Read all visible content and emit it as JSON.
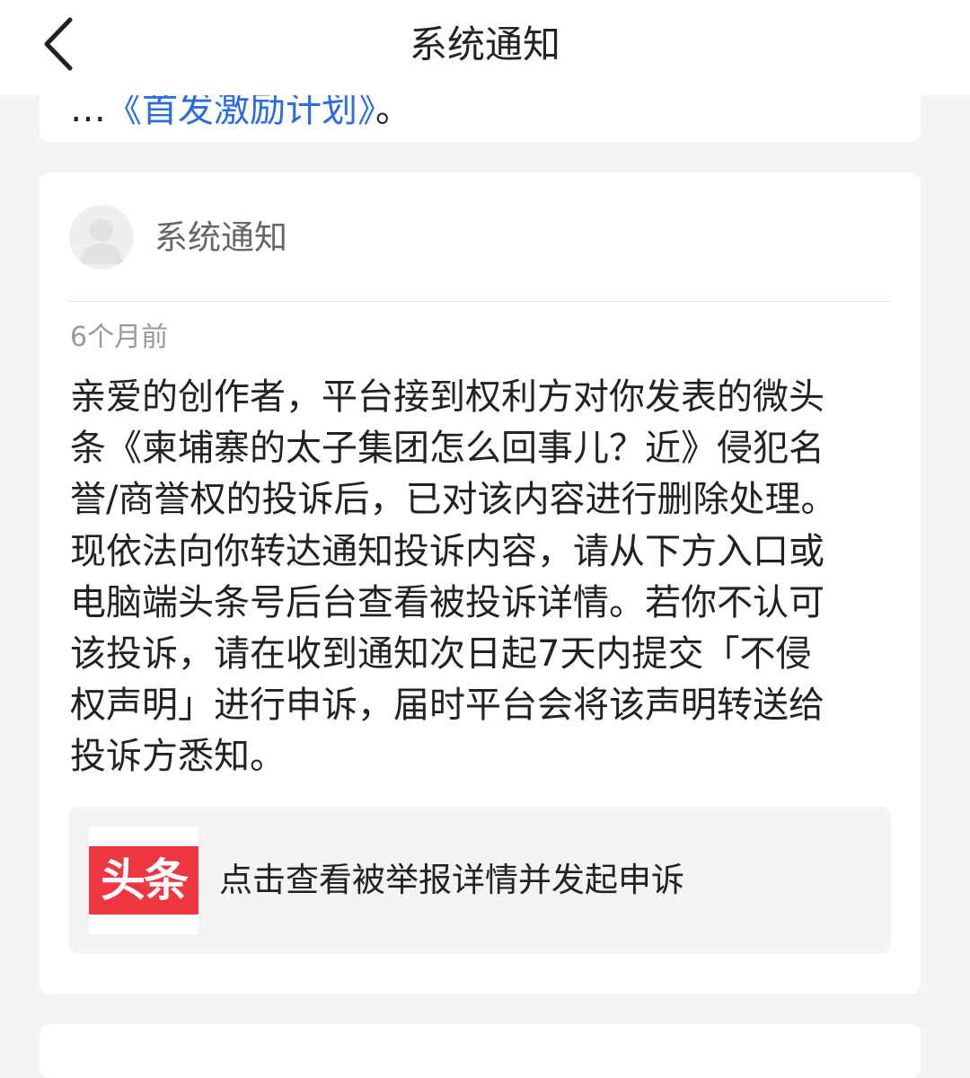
{
  "header": {
    "title": "系统通知"
  },
  "previous_card": {
    "text_prefix": "…",
    "link_text": "《首发激励计划》",
    "text_suffix": "。"
  },
  "notification": {
    "sender_name": "系统通知",
    "timestamp": "6个月前",
    "message_lines": [
      "亲爱的创作者，平台接到权利方对你发表的微头",
      "条《柬埔寨的太子集团怎么回事儿？近》侵犯名",
      "誉/商誉权的投诉后，已对该内容进行删除处理。",
      "现依法向你转达通知投诉内容，请从下方入口或",
      "电脑端头条号后台查看被投诉详情。若你不认可",
      "该投诉，请在收到通知次日起7天内提交「不侵",
      "权声明」进行申诉，届时平台会将该声明转送给",
      "投诉方悉知。"
    ],
    "action": {
      "logo_text": "头条",
      "label": "点击查看被举报详情并发起申诉"
    }
  },
  "colors": {
    "link": "#2b6de0",
    "logo_red": "#ef3742",
    "background": "#f4f4f4"
  }
}
